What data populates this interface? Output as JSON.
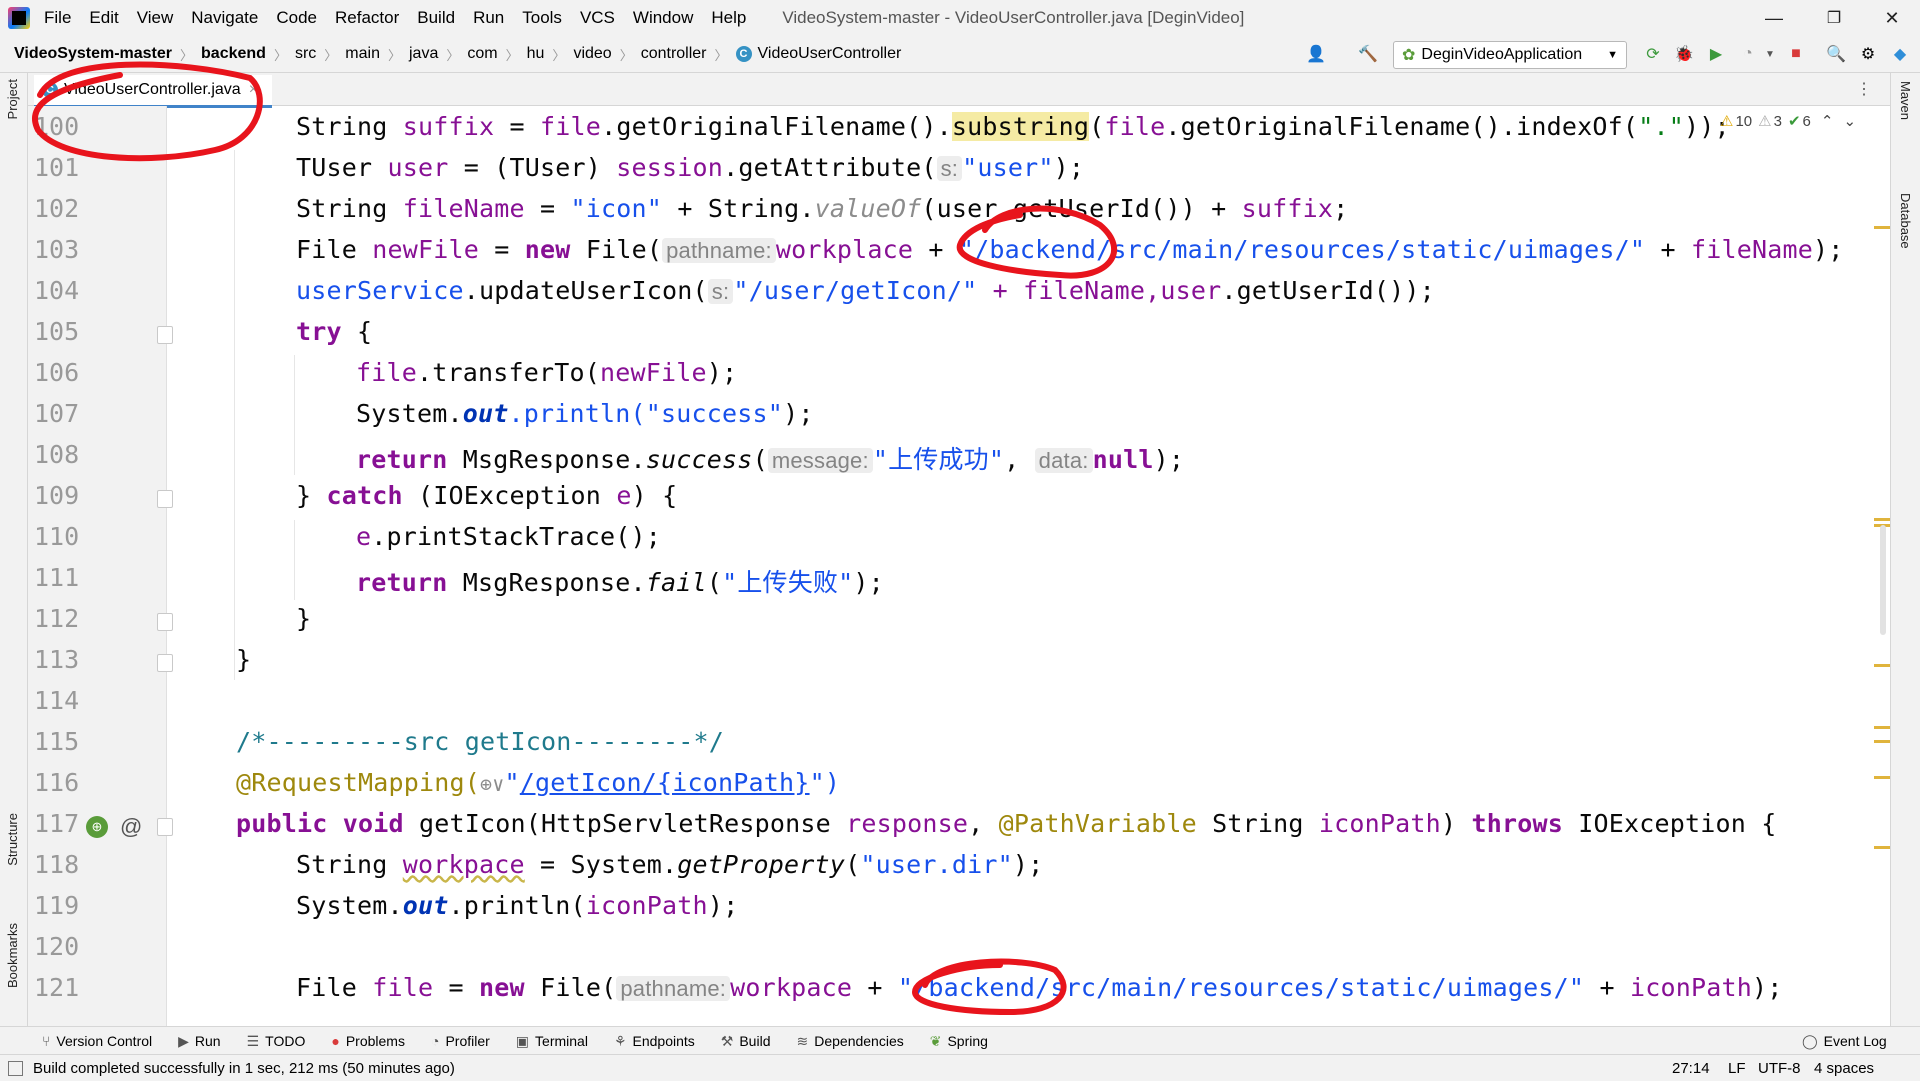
{
  "menu": {
    "items": [
      "File",
      "Edit",
      "View",
      "Navigate",
      "Code",
      "Refactor",
      "Build",
      "Run",
      "Tools",
      "VCS",
      "Window",
      "Help"
    ],
    "window_title": "VideoSystem-master - VideoUserController.java [DeginVideo]"
  },
  "window_controls": {
    "minimize": "—",
    "restore": "❐",
    "close": "✕"
  },
  "breadcrumb": [
    "VideoSystem-master",
    "backend",
    "src",
    "main",
    "java",
    "com",
    "hu",
    "video",
    "controller",
    "VideoUserController"
  ],
  "run_config": {
    "label": "DeginVideoApplication"
  },
  "tab": {
    "label": "VideoUserController.java",
    "close": "×"
  },
  "left_tools": {
    "project": "Project",
    "structure": "Structure",
    "bookmarks": "Bookmarks"
  },
  "right_tools": {
    "maven": "Maven",
    "database": "Database"
  },
  "inspections": {
    "warnings": "10",
    "weak_warnings": "3",
    "ok": "6"
  },
  "lines": [
    "100",
    "101",
    "102",
    "103",
    "104",
    "105",
    "106",
    "107",
    "108",
    "109",
    "110",
    "111",
    "112",
    "113",
    "114",
    "115",
    "116",
    "117",
    "118",
    "119",
    "120",
    "121"
  ],
  "code": {
    "l100": {
      "a": "String ",
      "b": "suffix",
      "c": " = ",
      "d": "file",
      "e": ".getOriginalFilename().",
      "f": "substring",
      "g": "(",
      "h": "file",
      "i": ".getOriginalFilename().indexOf(",
      "j": "\".\"",
      "k": "));"
    },
    "l101": {
      "a": "TUser ",
      "b": "user",
      "c": " = (TUser) ",
      "d": "session",
      "e": ".getAttribute(",
      "hint": "s:",
      "f": "\"user\"",
      "g": ");"
    },
    "l102": {
      "a": "String ",
      "b": "fileName",
      "c": " = ",
      "d": "\"icon\"",
      "e": " + String.",
      "f": "valueOf",
      "g": "(user.getUserId()) + ",
      "h": "suffix",
      "i": ";"
    },
    "l103": {
      "a": "File ",
      "b": "newFile",
      "c": " = ",
      "kw": "new",
      "d": " File(",
      "hint": "pathname:",
      "e": "workplace",
      "f": " + ",
      "g": "\"/backend/src/main/resources/static/uimages/\"",
      "h": " + ",
      "i": "fileName",
      "j": ");"
    },
    "l104": {
      "a": "userService",
      "b": ".updateUserIcon(",
      "hint": "s:",
      "c": "\"/user/getIcon/\"",
      "d": " + fileName,",
      "e": "user",
      "f": ".getUserId());"
    },
    "l105": {
      "kw": "try",
      "a": " {"
    },
    "l106": {
      "a": "file",
      "b": ".transferTo(",
      "c": "newFile",
      "d": ");"
    },
    "l107": {
      "a": "System.",
      "b": "out",
      "c": ".println(",
      "d": "\"success\"",
      "e": ");"
    },
    "l108": {
      "kw": "return",
      "a": " MsgResponse.",
      "b": "success",
      "c": "(",
      "hint1": "message:",
      "d": "\"上传成功\"",
      "e": ", ",
      "hint2": "data:",
      "kw2": "null",
      "f": ");"
    },
    "l109": {
      "a": "} ",
      "kw": "catch",
      "b": " (IOException ",
      "c": "e",
      "d": ") {"
    },
    "l110": {
      "a": "e",
      "b": ".printStackTrace();"
    },
    "l111": {
      "kw": "return",
      "a": " MsgResponse.",
      "b": "fail",
      "c": "(",
      "d": "\"上传失败\"",
      "e": ");"
    },
    "l112": {
      "a": "}"
    },
    "l113": {
      "a": "}"
    },
    "l115": {
      "a": "/*---------src getIcon--------*/"
    },
    "l116": {
      "a": "@RequestMapping(",
      "b": "⊕∨",
      "c": "\"",
      "d": "/getIcon/{iconPath}",
      "e": "\")"
    },
    "l117": {
      "kw1": "public",
      "kw2": "void",
      "a": " getIcon(HttpServletResponse ",
      "b": "response",
      "c": ", ",
      "d": "@PathVariable",
      "e": " String ",
      "f": "iconPath",
      "g": ") ",
      "kw3": "throws",
      "h": " IOException {"
    },
    "l118": {
      "a": "String ",
      "b": "workpace",
      "c": " = System.",
      "d": "getProperty",
      "e": "(",
      "f": "\"user.dir\"",
      "g": ");"
    },
    "l119": {
      "a": "System.",
      "b": "out",
      "c": ".println(",
      "d": "iconPath",
      "e": ");"
    },
    "l121": {
      "a": "File ",
      "b": "file",
      "c": " = ",
      "kw": "new",
      "d": " File(",
      "hint": "pathname:",
      "e": "workpace",
      "f": " + ",
      "g": "\"/backend/src/main/resources/static/uimages/\"",
      "h": " + ",
      "i": "iconPath",
      "j": ");"
    }
  },
  "bottom_tools": [
    "Version Control",
    "Run",
    "TODO",
    "Problems",
    "Profiler",
    "Terminal",
    "Endpoints",
    "Build",
    "Dependencies",
    "Spring"
  ],
  "event_log": "Event Log",
  "status": {
    "message": "Build completed successfully in 1 sec, 212 ms (50 minutes ago)",
    "position": "27:14",
    "line_sep": "LF",
    "encoding": "UTF-8",
    "indent": "4 spaces"
  },
  "colors": {
    "annotation_red": "#e8141c",
    "keyword": "#0033b3",
    "string": "#067d17"
  }
}
